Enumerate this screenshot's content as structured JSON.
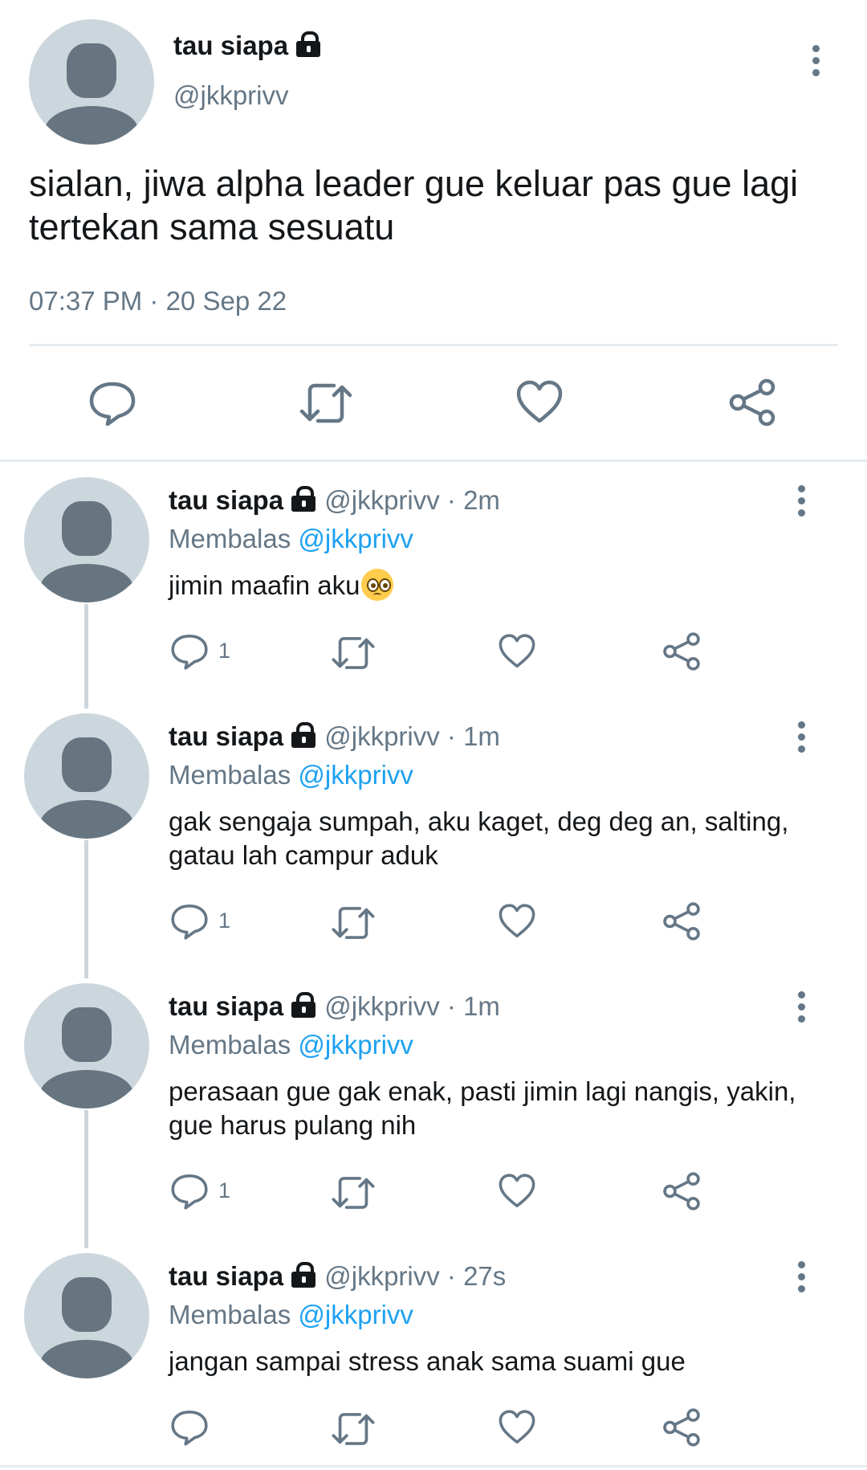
{
  "main_tweet": {
    "name": "tau siapa",
    "handle": "@jkkprivv",
    "text": "sialan, jiwa alpha leader gue keluar pas gue lagi tertekan sama sesuatu",
    "timestamp": "07:37 PM · 20 Sep 22",
    "icons": [
      "comment-icon",
      "retweet-icon",
      "like-icon",
      "share-icon",
      "more-icon",
      "lock-icon"
    ]
  },
  "replies": [
    {
      "name": "tau siapa",
      "handle": "@jkkprivv",
      "time": "· 2m",
      "reply_label": "Membalas",
      "reply_to": "@jkkprivv",
      "text": "jimin maafin aku",
      "emoji": "pleading-face-emoji",
      "comment_count": "1"
    },
    {
      "name": "tau siapa",
      "handle": "@jkkprivv",
      "time": "· 1m",
      "reply_label": "Membalas",
      "reply_to": "@jkkprivv",
      "text": "gak sengaja sumpah, aku kaget, deg deg an, salting, gatau lah campur aduk",
      "comment_count": "1"
    },
    {
      "name": "tau siapa",
      "handle": "@jkkprivv",
      "time": "· 1m",
      "reply_label": "Membalas",
      "reply_to": "@jkkprivv",
      "text": "perasaan gue gak enak, pasti jimin lagi nangis, yakin, gue harus pulang nih",
      "comment_count": "1"
    },
    {
      "name": "tau siapa",
      "handle": "@jkkprivv",
      "time": "· 27s",
      "reply_label": "Membalas",
      "reply_to": "@jkkprivv",
      "text": "jangan sampai stress anak sama suami gue",
      "comment_count": ""
    }
  ],
  "colors": {
    "text": "#14171a",
    "secondary": "#657786",
    "link": "#1da1f2",
    "avatar_bg": "#ccd6dd",
    "avatar_fg": "#66757f",
    "divider": "#e6ecf0"
  }
}
